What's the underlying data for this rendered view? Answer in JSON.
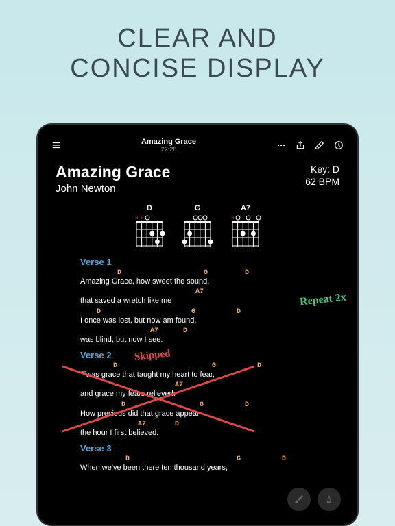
{
  "hero": {
    "line1": "CLEAR AND",
    "line2": "CONCISE DISPLAY"
  },
  "appbar": {
    "title": "Amazing Grace",
    "subtitle": "22:28"
  },
  "song": {
    "title": "Amazing Grace",
    "author": "John Newton",
    "key": "Key: D",
    "bpm": "62 BPM"
  },
  "chords": {
    "c1": "D",
    "c2": "G",
    "c3": "A7"
  },
  "verse1": {
    "title": "Verse 1",
    "c1": "         D                    G         D",
    "l1": "Amazing Grace, how sweet the sound,",
    "c2": "                            A7",
    "l2": "that saved a wretch like me",
    "c3": "    D                      G          D",
    "l3": "I once was lost, but now am found,",
    "c4": "                 A7      D",
    "l4": "was blind, but now I see."
  },
  "verse2": {
    "title": "Verse 2",
    "c1": "        D                       G          D",
    "l1": "'Twas grace that taught my heart to fear,",
    "c2": "                       A7",
    "l2": "and grace my fears relieved.",
    "c3": "          D                  G          D",
    "l3": "How precious did that grace appear,",
    "c4": "              A7       D",
    "l4": "the hour I first believed."
  },
  "verse3": {
    "title": "Verse 3",
    "c1": "           D                          G          D",
    "l1": "When we've been there ten thousand years,"
  },
  "annotations": {
    "repeat": "Repeat 2x",
    "skipped": "Skipped"
  }
}
